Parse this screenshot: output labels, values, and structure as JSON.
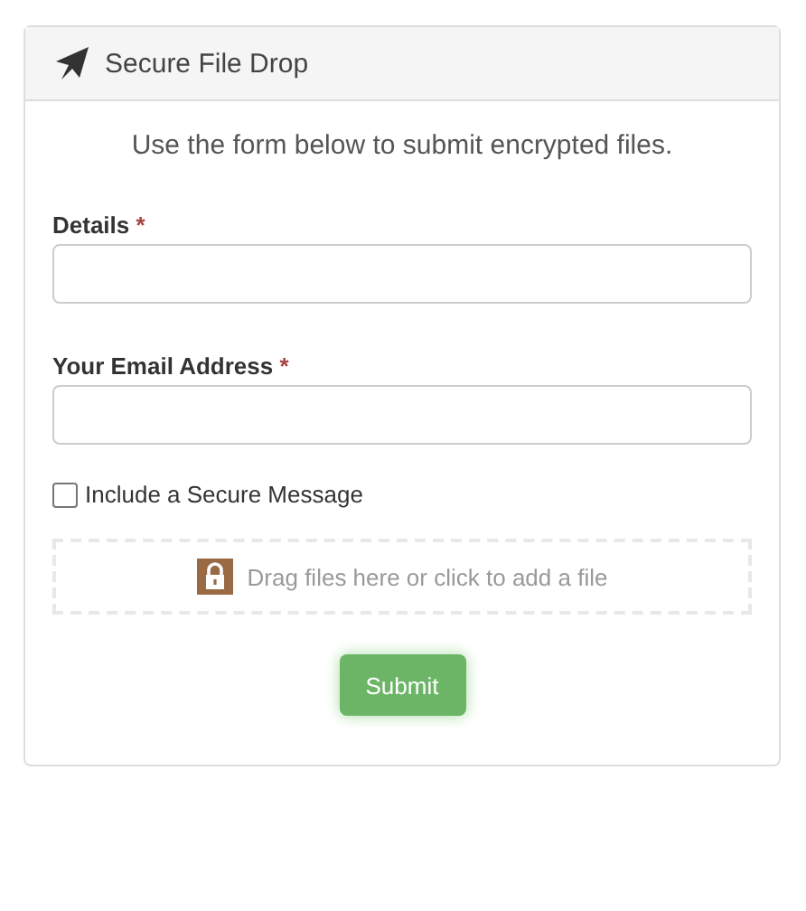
{
  "panel": {
    "title": "Secure File Drop"
  },
  "intro": "Use the form below to submit encrypted files.",
  "fields": [
    {
      "label": "Details",
      "required_mark": "*"
    },
    {
      "label": "Your Email Address",
      "required_mark": "*"
    }
  ],
  "option": {
    "label": "Include a Secure Message",
    "checked": false
  },
  "dropzone": {
    "text": "Drag files here or click to add a file"
  },
  "submit": "Submit"
}
